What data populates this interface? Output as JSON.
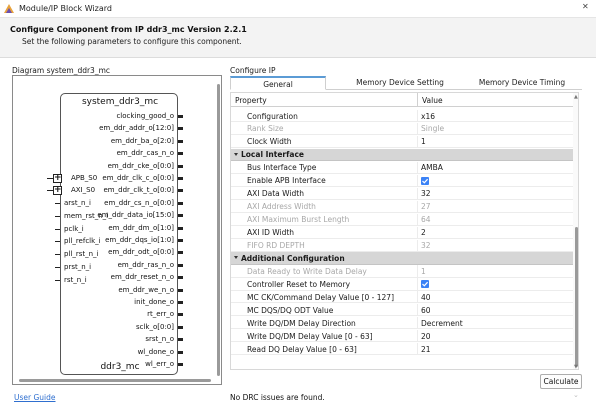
{
  "window": {
    "title": "Module/IP Block Wizard",
    "close_symbol": "✕"
  },
  "header": {
    "title": "Configure Component from IP ddr3_mc Version 2.2.1",
    "subtitle": "Set the following parameters to configure this component."
  },
  "diagram": {
    "label": "Diagram system_ddr3_mc",
    "block_title": "system_ddr3_mc",
    "block_bottom": "ddr3_mc",
    "right_ports": [
      "clocking_good_o",
      "em_ddr_addr_o[12:0]",
      "em_ddr_ba_o[2:0]",
      "em_ddr_cas_n_o",
      "em_ddr_cke_o[0:0]",
      "em_ddr_clk_c_o[0:0]",
      "em_ddr_clk_t_o[0:0]",
      "em_ddr_cs_n_o[0:0]",
      "em_ddr_data_io[15:0]",
      "em_ddr_dm_o[1:0]",
      "em_ddr_dqs_io[1:0]",
      "em_ddr_odt_o[0:0]",
      "em_ddr_ras_n_o",
      "em_ddr_reset_n_o",
      "em_ddr_we_n_o",
      "init_done_o",
      "rt_err_o",
      "sclk_o[0:0]",
      "srst_n_o",
      "wl_done_o",
      "wl_err_o"
    ],
    "left_ports": [
      "APB_S0",
      "AXI_S0",
      "arst_n_i",
      "mem_rst_n_i",
      "pclk_i",
      "pll_refclk_i",
      "pll_rst_n_i",
      "prst_n_i",
      "rst_n_i"
    ],
    "bus_symbol": "+"
  },
  "config": {
    "label": "Configure IP",
    "tabs": [
      "General",
      "Memory Device Setting",
      "Memory Device Timing"
    ],
    "active_tab": "General",
    "columns": {
      "property": "Property",
      "value": "Value"
    },
    "rows": [
      {
        "type": "item",
        "label": "Configuration",
        "value": "x16",
        "disabled": false
      },
      {
        "type": "item",
        "label": "Rank Size",
        "value": "Single",
        "disabled": true
      },
      {
        "type": "item",
        "label": "Clock Width",
        "value": "1",
        "disabled": false
      },
      {
        "type": "section",
        "label": "Local Interface"
      },
      {
        "type": "item",
        "label": "Bus Interface Type",
        "value": "AMBA",
        "disabled": false
      },
      {
        "type": "check",
        "label": "Enable APB Interface",
        "checked": true,
        "disabled": false
      },
      {
        "type": "item",
        "label": "AXI Data Width",
        "value": "32",
        "disabled": false
      },
      {
        "type": "item",
        "label": "AXI Address Width",
        "value": "27",
        "disabled": true
      },
      {
        "type": "item",
        "label": "AXI Maximum Burst Length",
        "value": "64",
        "disabled": true
      },
      {
        "type": "item",
        "label": "AXI ID Width",
        "value": "2",
        "disabled": false
      },
      {
        "type": "item",
        "label": "FIFO RD DEPTH",
        "value": "32",
        "disabled": true
      },
      {
        "type": "section",
        "label": "Additional Configuration"
      },
      {
        "type": "item",
        "label": "Data Ready to Write Data Delay",
        "value": "1",
        "disabled": true
      },
      {
        "type": "check",
        "label": "Controller Reset to Memory",
        "checked": true,
        "disabled": false
      },
      {
        "type": "item",
        "label": "MC CK/Command Delay Value  [0 - 127]",
        "value": "40",
        "disabled": false
      },
      {
        "type": "item",
        "label": "MC DQS/DQ ODT Value",
        "value": "60",
        "disabled": false
      },
      {
        "type": "item",
        "label": "Write DQ/DM Delay Direction",
        "value": "Decrement",
        "disabled": false
      },
      {
        "type": "item",
        "label": "Write DQ/DM Delay Value  [0 - 63]",
        "value": "20",
        "disabled": false
      },
      {
        "type": "item",
        "label": "Read DQ Delay Value  [0 - 63]",
        "value": "21",
        "disabled": false
      }
    ]
  },
  "footer": {
    "calculate": "Calculate",
    "user_guide": "User Guide",
    "drc_status": "No DRC issues are found.",
    "chevron": "⌄"
  },
  "colors": {
    "accent": "#3b82f6",
    "section_bg": "#d6d6d6",
    "link": "#2f6fcf"
  }
}
